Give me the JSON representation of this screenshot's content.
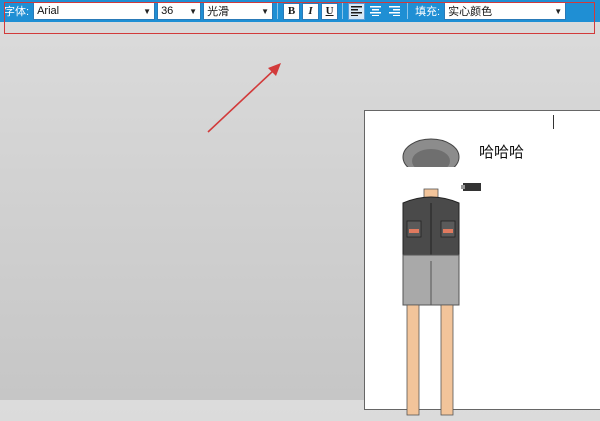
{
  "toolbar": {
    "font_label": "字体:",
    "font_value": "Arial",
    "size_value": "36",
    "smooth_value": "光滑",
    "bold_label": "B",
    "italic_label": "I",
    "underline_label": "U",
    "fill_label": "填充:",
    "fill_value": "实心颜色",
    "colors": {
      "bar": "#1f8fd4",
      "highlight_frame": "#d23a3a"
    }
  },
  "canvas": {
    "text": "哈哈哈"
  },
  "annotation": {
    "color": "#d23a3a"
  }
}
